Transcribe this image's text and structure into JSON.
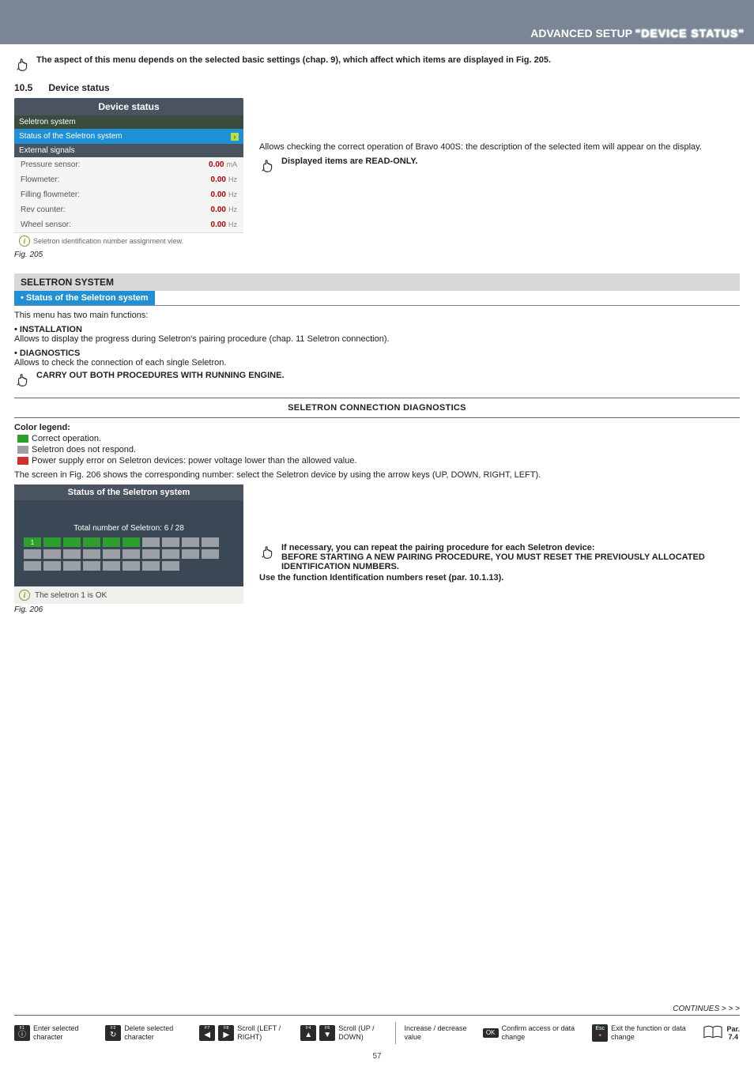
{
  "header": {
    "title_left": "ADVANCED SETUP ",
    "title_quoted": "\"DEVICE STATUS\""
  },
  "intro_note": "The aspect of this menu depends on the selected basic settings (chap. 9), which affect which items are displayed in Fig. 205.",
  "section": {
    "number": "10.5",
    "title": "Device status"
  },
  "panel205": {
    "title": "Device status",
    "seletron_label": "Seletron system",
    "status_row": "Status of the Seletron system",
    "external_label": "External signals",
    "rows": [
      {
        "label": "Pressure sensor:",
        "value": "0.00",
        "unit": "mA"
      },
      {
        "label": "Flowmeter:",
        "value": "0.00",
        "unit": "Hz"
      },
      {
        "label": "Filling flowmeter:",
        "value": "0.00",
        "unit": "Hz"
      },
      {
        "label": "Rev counter:",
        "value": "0.00",
        "unit": "Hz"
      },
      {
        "label": "Wheel sensor:",
        "value": "0.00",
        "unit": "Hz"
      }
    ],
    "footer": "Seletron identification number assignment view.",
    "caption": "Fig. 205"
  },
  "right_of_205": {
    "para": "Allows checking the correct operation of Bravo 400S: the description of the selected item will appear on the display.",
    "note": "Displayed items are READ-ONLY."
  },
  "seletron_block": {
    "grey_title": "SELETRON SYSTEM",
    "blue_title": "• Status of the Seletron system",
    "intro": "This menu has two main functions:",
    "install_h": "• INSTALLATION",
    "install_p": "Allows to display the progress during Seletron's pairing procedure (chap. 11 Seletron connection).",
    "diag_h": "• DIAGNOSTICS",
    "diag_p": "Allows to check the connection of each single Seletron.",
    "engine_note": " CARRY OUT BOTH PROCEDURES WITH RUNNING ENGINE."
  },
  "diag_section": {
    "heading": "SELETRON CONNECTION DIAGNOSTICS",
    "legend_title": "Color legend:",
    "legend": [
      {
        "color": "green",
        "text": "Correct operation."
      },
      {
        "color": "grey",
        "text": "Seletron does not respond."
      },
      {
        "color": "red",
        "text": "Power supply error on Seletron devices: power voltage lower than the allowed value."
      }
    ],
    "screen_intro": "The screen in Fig. 206 shows the corresponding number: select the Seletron device by using the arrow keys (UP, DOWN, RIGHT, LEFT)."
  },
  "panel206": {
    "title": "Status of the Seletron system",
    "count_label": "Total number of Seletron:  6 / 28",
    "selected_num": "1",
    "footer": "The seletron 1 is OK",
    "caption": "Fig. 206"
  },
  "right_of_206": {
    "line1": " If necessary, you can repeat the pairing procedure for each Seletron device:",
    "line2": "BEFORE STARTING A NEW PAIRING PROCEDURE, YOU MUST RESET THE PREVIOUSLY ALLOCATED IDENTIFICATION NUMBERS.",
    "line3a": "Use the function ",
    "line3b": "Identification numbers reset",
    "line3c": " (par. 10.1.13)."
  },
  "continues": "CONTINUES > > >",
  "footer_keys": {
    "f1": {
      "k": "F1",
      "text": "Enter selected character"
    },
    "f2": {
      "k": "F2",
      "text": "Delete selected character"
    },
    "f78": {
      "k1": "F7",
      "k2": "F8",
      "text": "Scroll (LEFT / RIGHT)"
    },
    "f46": {
      "k1": "F4",
      "k2": "F6",
      "text": "Scroll (UP / DOWN)"
    },
    "updown": {
      "text": "Increase / decrease value"
    },
    "ok": {
      "k": "OK",
      "text": "Confirm access or data change"
    },
    "esc": {
      "k": "Esc",
      "text": "Exit the function or data change"
    },
    "ref": {
      "top": "Par.",
      "bottom": "7.4"
    }
  },
  "page_number": "57"
}
